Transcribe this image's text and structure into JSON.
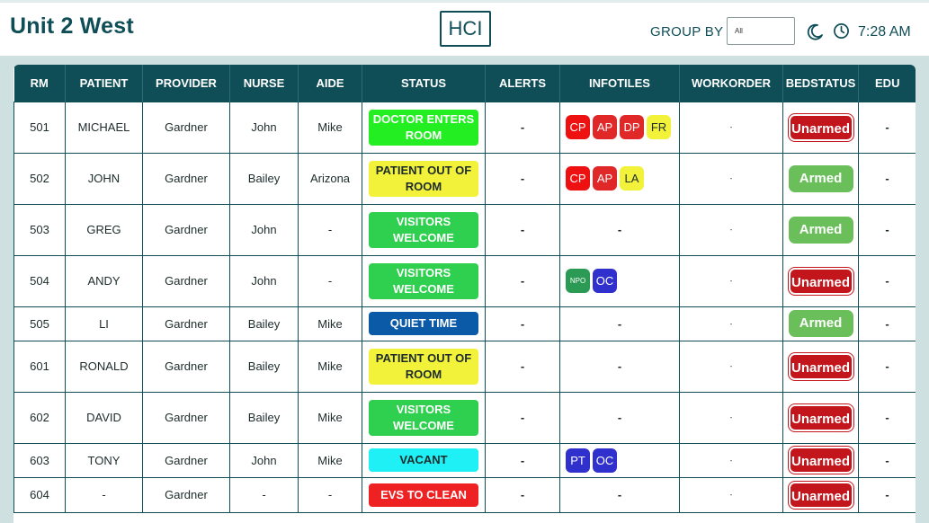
{
  "header": {
    "title": "Unit 2 West",
    "logo": "HCI",
    "group_by_label": "GROUP BY",
    "group_by_value": "All",
    "time": "7:28 AM"
  },
  "icons": {
    "theme": "moon-icon",
    "clock": "clock-icon"
  },
  "columns": [
    "RM",
    "PATIENT",
    "PROVIDER",
    "NURSE",
    "AIDE",
    "STATUS",
    "ALERTS",
    "INFOTILES",
    "WORKORDER",
    "BEDSTATUS",
    "EDU"
  ],
  "colors": {
    "header_bg": "#0f4e57",
    "armed": "#6abf5a",
    "unarmed": "#c3161c"
  },
  "status_styles": {
    "DOCTOR ENTERS ROOM": {
      "bg": "#22ee22",
      "fg": "#ffffff"
    },
    "PATIENT OUT OF ROOM": {
      "bg": "#f2f23a",
      "fg": "#1d2b2b"
    },
    "VISITORS WELCOME": {
      "bg": "#2fcf4f",
      "fg": "#ffffff"
    },
    "QUIET TIME": {
      "bg": "#0b5aa8",
      "fg": "#ffffff"
    },
    "VACANT": {
      "bg": "#1ff0f5",
      "fg": "#1d2b2b"
    },
    "EVS TO CLEAN": {
      "bg": "#ee2222",
      "fg": "#ffffff"
    }
  },
  "tile_styles": {
    "CP": {
      "bg": "#ee1111",
      "fg": "#ffffff"
    },
    "AP": {
      "bg": "#e02828",
      "fg": "#ffffff"
    },
    "DP": {
      "bg": "#e02828",
      "fg": "#ffffff"
    },
    "FR": {
      "bg": "#f2f23a",
      "fg": "#1d2b2b"
    },
    "LA": {
      "bg": "#f2f23a",
      "fg": "#1d2b2b"
    },
    "NPO": {
      "bg": "#2a9a55",
      "fg": "#ffffff"
    },
    "OC": {
      "bg": "#3030cc",
      "fg": "#ffffff"
    },
    "PT": {
      "bg": "#3030cc",
      "fg": "#ffffff"
    }
  },
  "rows": [
    {
      "rm": "501",
      "patient": "MICHAEL",
      "provider": "Gardner",
      "nurse": "John",
      "aide": "Mike",
      "status": "DOCTOR ENTERS ROOM",
      "alerts": "-",
      "infotiles": [
        "CP",
        "AP",
        "DP",
        "FR"
      ],
      "workorder": "-",
      "bedstatus": "Unarmed",
      "edu": "-"
    },
    {
      "rm": "502",
      "patient": "JOHN",
      "provider": "Gardner",
      "nurse": "Bailey",
      "aide": "Arizona",
      "status": "PATIENT OUT OF ROOM",
      "alerts": "-",
      "infotiles": [
        "CP",
        "AP",
        "LA"
      ],
      "workorder": "-",
      "bedstatus": "Armed",
      "edu": "-"
    },
    {
      "rm": "503",
      "patient": "GREG",
      "provider": "Gardner",
      "nurse": "John",
      "aide": "-",
      "status": "VISITORS WELCOME",
      "alerts": "-",
      "infotiles": [],
      "workorder": "-",
      "bedstatus": "Armed",
      "edu": "-"
    },
    {
      "rm": "504",
      "patient": "ANDY",
      "provider": "Gardner",
      "nurse": "John",
      "aide": "-",
      "status": "VISITORS WELCOME",
      "alerts": "-",
      "infotiles": [
        "NPO",
        "OC"
      ],
      "workorder": "-",
      "bedstatus": "Unarmed",
      "edu": "-"
    },
    {
      "rm": "505",
      "patient": "LI",
      "provider": "Gardner",
      "nurse": "Bailey",
      "aide": "Mike",
      "status": "QUIET TIME",
      "alerts": "-",
      "infotiles": [],
      "workorder": "-",
      "bedstatus": "Armed",
      "edu": "-"
    },
    {
      "rm": "601",
      "patient": "RONALD",
      "provider": "Gardner",
      "nurse": "Bailey",
      "aide": "Mike",
      "status": "PATIENT OUT OF ROOM",
      "alerts": "-",
      "infotiles": [],
      "workorder": "-",
      "bedstatus": "Unarmed",
      "edu": "-"
    },
    {
      "rm": "602",
      "patient": "DAVID",
      "provider": "Gardner",
      "nurse": "Bailey",
      "aide": "Mike",
      "status": "VISITORS WELCOME",
      "alerts": "-",
      "infotiles": [],
      "workorder": "-",
      "bedstatus": "Unarmed",
      "edu": "-"
    },
    {
      "rm": "603",
      "patient": "TONY",
      "provider": "Gardner",
      "nurse": "John",
      "aide": "Mike",
      "status": "VACANT",
      "alerts": "-",
      "infotiles": [
        "PT",
        "OC"
      ],
      "workorder": "-",
      "bedstatus": "Unarmed",
      "edu": "-"
    },
    {
      "rm": "604",
      "patient": "-",
      "provider": "Gardner",
      "nurse": "-",
      "aide": "-",
      "status": "EVS TO CLEAN",
      "alerts": "-",
      "infotiles": [],
      "workorder": "-",
      "bedstatus": "Unarmed",
      "edu": "-"
    }
  ]
}
